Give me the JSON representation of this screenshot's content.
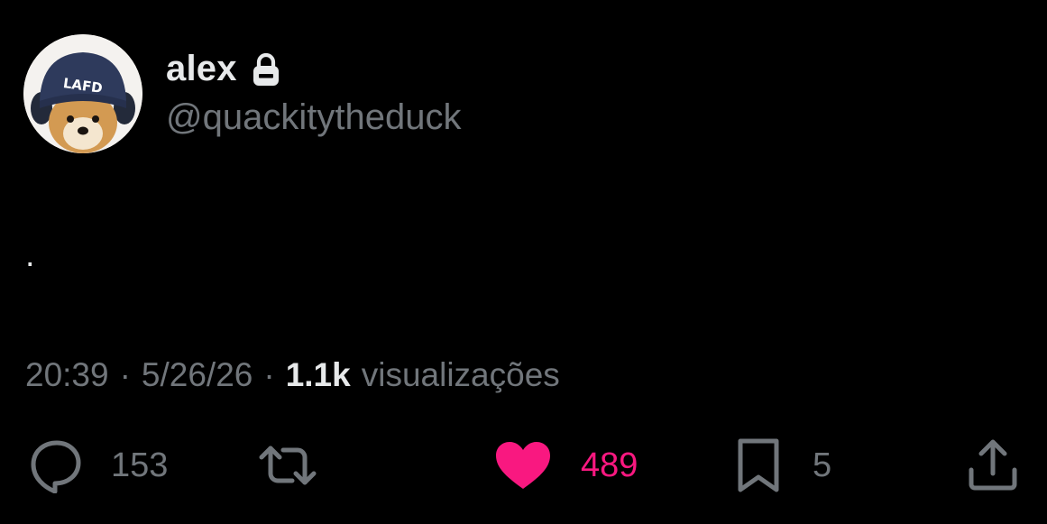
{
  "author": {
    "display_name": "alex",
    "handle": "@quackitytheduck",
    "avatar_hat_text": "LAFD",
    "protected_icon": "lock-icon"
  },
  "tweet": {
    "text": "."
  },
  "meta": {
    "time": "20:39",
    "separator": "·",
    "date": "5/26/26",
    "views_count": "1.1k",
    "views_label": "visualizações"
  },
  "actions": {
    "reply": {
      "icon": "speech-bubble-icon",
      "count": "153"
    },
    "retweet": {
      "icon": "retweet-icon"
    },
    "like": {
      "icon": "heart-icon",
      "count": "489",
      "active": true
    },
    "bookmark": {
      "icon": "bookmark-icon",
      "count": "5"
    },
    "share": {
      "icon": "share-icon"
    }
  },
  "colors": {
    "background": "#000000",
    "primary_text": "#e7e9ea",
    "secondary_text": "#71767b",
    "like_active": "#f91880"
  }
}
